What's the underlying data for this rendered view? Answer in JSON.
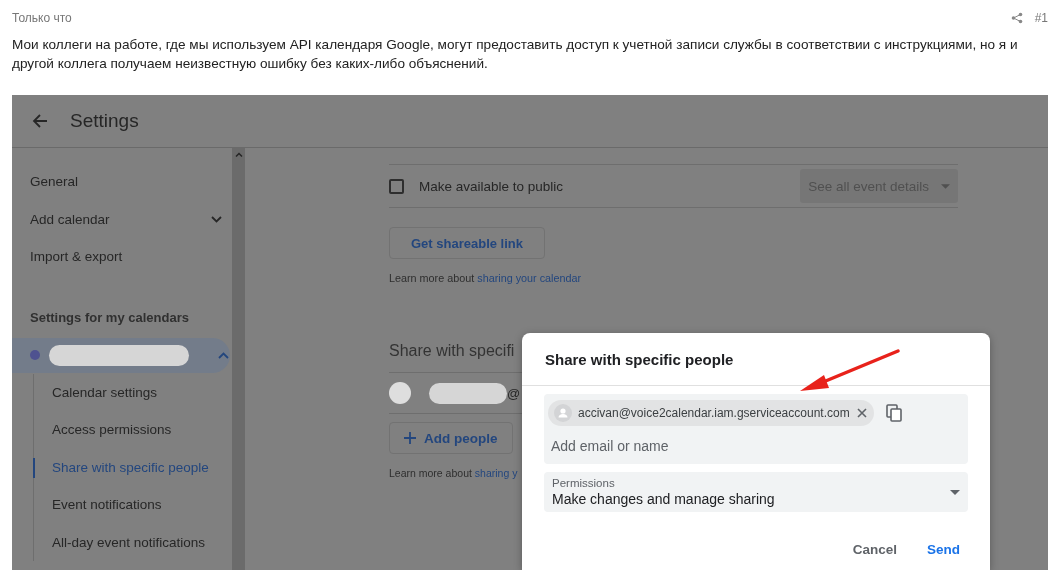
{
  "post": {
    "time": "Только что",
    "number": "#1",
    "text": "Мои коллеги на работе, где мы используем API календаря Google, могут предоставить доступ к учетной записи службы в соответствии с инструкциями, но я и другой коллега получаем неизвестную ошибку без каких-либо объяснений."
  },
  "settings": {
    "title": "Settings",
    "nav": [
      {
        "label": "General",
        "expandable": false
      },
      {
        "label": "Add calendar",
        "expandable": true
      },
      {
        "label": "Import & export",
        "expandable": false
      }
    ],
    "section_heading": "Settings for my calendars",
    "calendar": {
      "expanded": true
    },
    "subnav": [
      {
        "label": "Calendar settings",
        "selected": false
      },
      {
        "label": "Access permissions",
        "selected": false
      },
      {
        "label": "Share with specific people",
        "selected": true
      },
      {
        "label": "Event notifications",
        "selected": false
      },
      {
        "label": "All-day event notifications",
        "selected": false
      }
    ],
    "public_access": {
      "label": "Make available to public",
      "checked": false,
      "dropdown": "See all event details"
    },
    "shareable_link_button": "Get shareable link",
    "learn_more_1": {
      "text": "Learn more about",
      "link": "sharing your calendar"
    },
    "share_heading": "Share with specifi",
    "shared_person": {
      "suffix": "@"
    },
    "add_people_button": "Add people",
    "learn_more_2": {
      "text": "Learn more about",
      "link": "sharing y"
    }
  },
  "dialog": {
    "title": "Share with specific people",
    "chips": [
      {
        "email": "accivan@voice2calendar.iam.gserviceaccount.com"
      }
    ],
    "placeholder": "Add email or name",
    "permissions": {
      "label": "Permissions",
      "value": "Make changes and manage sharing"
    },
    "buttons": [
      {
        "label": "Cancel",
        "kind": "text"
      },
      {
        "label": "Send",
        "kind": "primary"
      }
    ]
  }
}
